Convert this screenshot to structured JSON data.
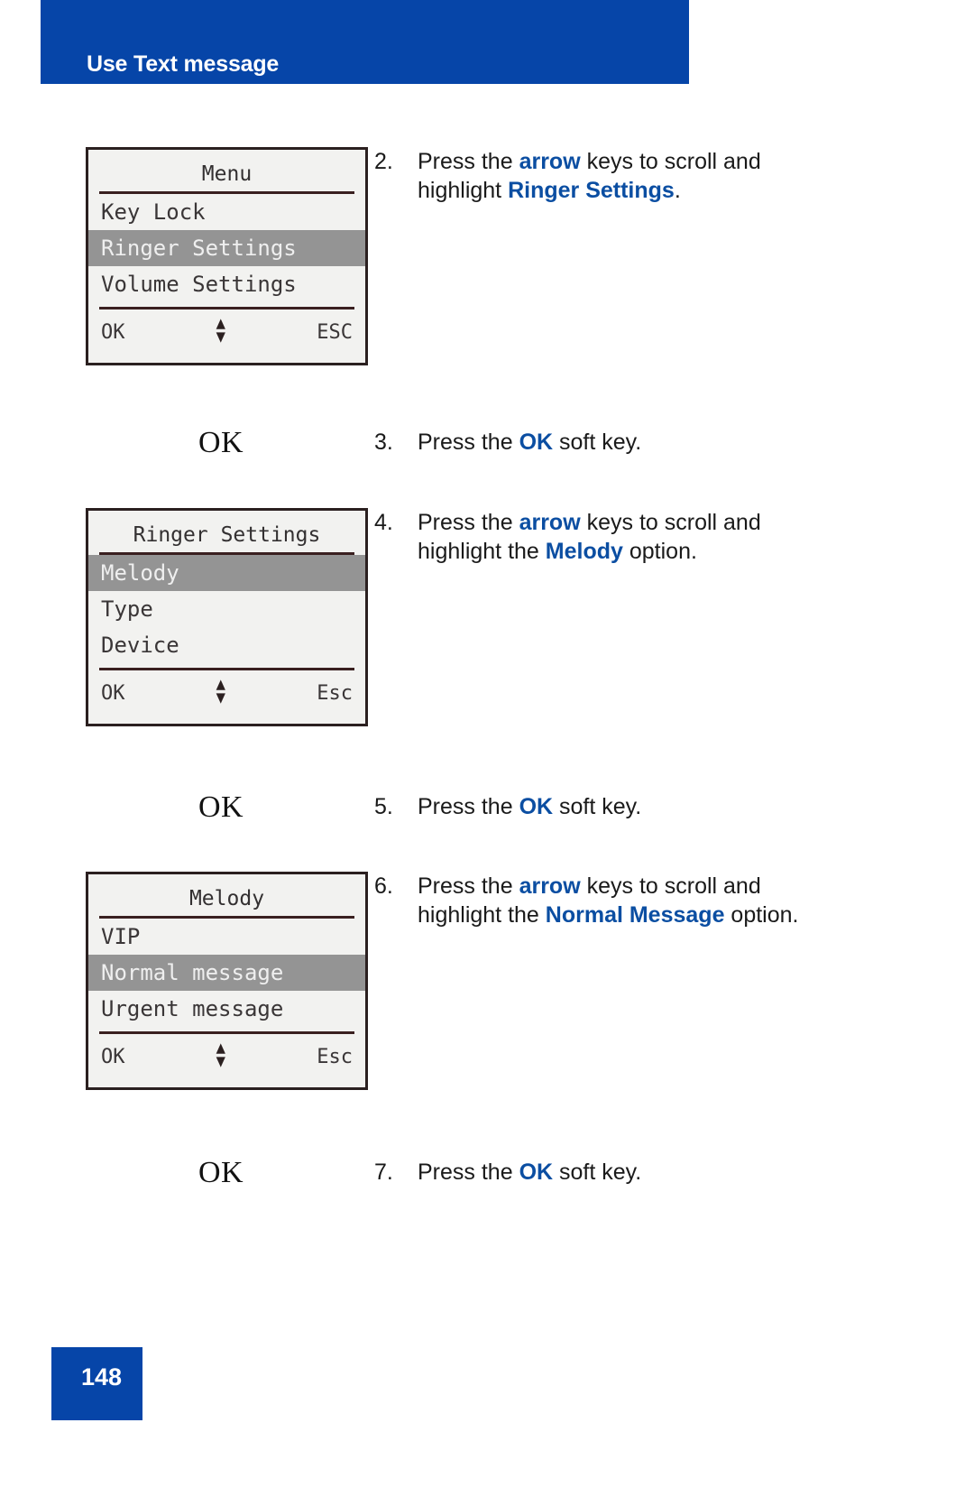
{
  "header": {
    "title": "Use Text message",
    "banner_color": "#0645a8"
  },
  "accent_color": "#0b4ea2",
  "screens": [
    {
      "name": "menu-screen",
      "title": "Menu",
      "items": [
        {
          "label": "Key Lock",
          "highlighted": false
        },
        {
          "label": "Ringer Settings",
          "highlighted": true
        },
        {
          "label": "Volume Settings",
          "highlighted": false
        }
      ],
      "footer": {
        "left": "OK",
        "scroll_icon": "up-down-arrow-icon",
        "right": "ESC"
      }
    },
    {
      "name": "ringer-settings-screen",
      "title": "Ringer Settings",
      "items": [
        {
          "label": "Melody",
          "highlighted": true
        },
        {
          "label": "Type",
          "highlighted": false
        },
        {
          "label": "Device",
          "highlighted": false
        }
      ],
      "footer": {
        "left": "OK",
        "scroll_icon": "up-down-arrow-icon",
        "right": "Esc"
      }
    },
    {
      "name": "melody-screen",
      "title": "Melody",
      "items": [
        {
          "label": "VIP",
          "highlighted": false
        },
        {
          "label": "Normal message",
          "highlighted": true
        },
        {
          "label": "Urgent message",
          "highlighted": false
        }
      ],
      "footer": {
        "left": "OK",
        "scroll_icon": "up-down-arrow-icon",
        "right": "Esc"
      }
    }
  ],
  "softkeys": [
    {
      "label": "OK"
    },
    {
      "label": "OK"
    },
    {
      "label": "OK"
    }
  ],
  "steps": [
    {
      "number": "2.",
      "parts": [
        {
          "t": "Press the ",
          "kw": false
        },
        {
          "t": "arrow",
          "kw": true
        },
        {
          "t": " keys to scroll and highlight ",
          "kw": false
        },
        {
          "t": "Ringer Settings",
          "kw": true
        },
        {
          "t": ".",
          "kw": false
        }
      ]
    },
    {
      "number": "3.",
      "parts": [
        {
          "t": "Press the ",
          "kw": false
        },
        {
          "t": "OK",
          "kw": true
        },
        {
          "t": " soft key.",
          "kw": false
        }
      ]
    },
    {
      "number": "4.",
      "parts": [
        {
          "t": "Press the ",
          "kw": false
        },
        {
          "t": "arrow",
          "kw": true
        },
        {
          "t": " keys to scroll and highlight the ",
          "kw": false
        },
        {
          "t": "Melody",
          "kw": true
        },
        {
          "t": " option.",
          "kw": false
        }
      ]
    },
    {
      "number": "5.",
      "parts": [
        {
          "t": "Press the ",
          "kw": false
        },
        {
          "t": "OK",
          "kw": true
        },
        {
          "t": " soft key.",
          "kw": false
        }
      ]
    },
    {
      "number": "6.",
      "parts": [
        {
          "t": "Press the ",
          "kw": false
        },
        {
          "t": "arrow",
          "kw": true
        },
        {
          "t": " keys to scroll and highlight the ",
          "kw": false
        },
        {
          "t": "Normal Message",
          "kw": true
        },
        {
          "t": " option.",
          "kw": false
        }
      ]
    },
    {
      "number": "7.",
      "parts": [
        {
          "t": "Press the ",
          "kw": false
        },
        {
          "t": "OK",
          "kw": true
        },
        {
          "t": " soft key.",
          "kw": false
        }
      ]
    }
  ],
  "footer": {
    "page_number": "148"
  }
}
